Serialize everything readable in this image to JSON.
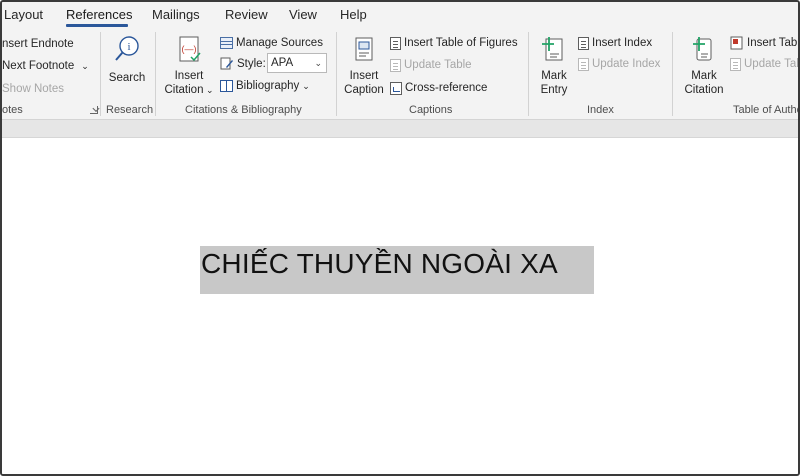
{
  "tabs": [
    {
      "label": "Layout",
      "active": false
    },
    {
      "label": "References",
      "active": true
    },
    {
      "label": "Mailings",
      "active": false
    },
    {
      "label": "Review",
      "active": false
    },
    {
      "label": "View",
      "active": false
    },
    {
      "label": "Help",
      "active": false
    }
  ],
  "ribbon": {
    "footnotes": {
      "insert_endnote": "nsert Endnote",
      "next_footnote": "Next Footnote",
      "show_notes": "Show Notes",
      "group_label": "otes"
    },
    "research": {
      "search": "Search",
      "group_label": "Research"
    },
    "citations": {
      "insert_citation_line1": "Insert",
      "insert_citation_line2": "Citation",
      "manage_sources": "Manage Sources",
      "style_label": "Style:",
      "style_value": "APA",
      "bibliography": "Bibliography",
      "group_label": "Citations & Bibliography"
    },
    "captions": {
      "insert_caption_line1": "Insert",
      "insert_caption_line2": "Caption",
      "insert_table_of_figures": "Insert Table of Figures",
      "update_table": "Update Table",
      "cross_reference": "Cross-reference",
      "group_label": "Captions"
    },
    "index": {
      "mark_entry_line1": "Mark",
      "mark_entry_line2": "Entry",
      "insert_index": "Insert Index",
      "update_index": "Update Index",
      "group_label": "Index"
    },
    "authorities": {
      "mark_citation_line1": "Mark",
      "mark_citation_line2": "Citation",
      "insert_table": "Insert Table",
      "update_table": "Update Table",
      "group_label": "Table of Authe"
    }
  },
  "document": {
    "selected_text": "CHIẾC THUYỀN NGOÀI XA"
  },
  "colors": {
    "accent": "#2b579a",
    "selection": "#c8c8c8",
    "ribbon_bg": "#f3f3f3"
  }
}
